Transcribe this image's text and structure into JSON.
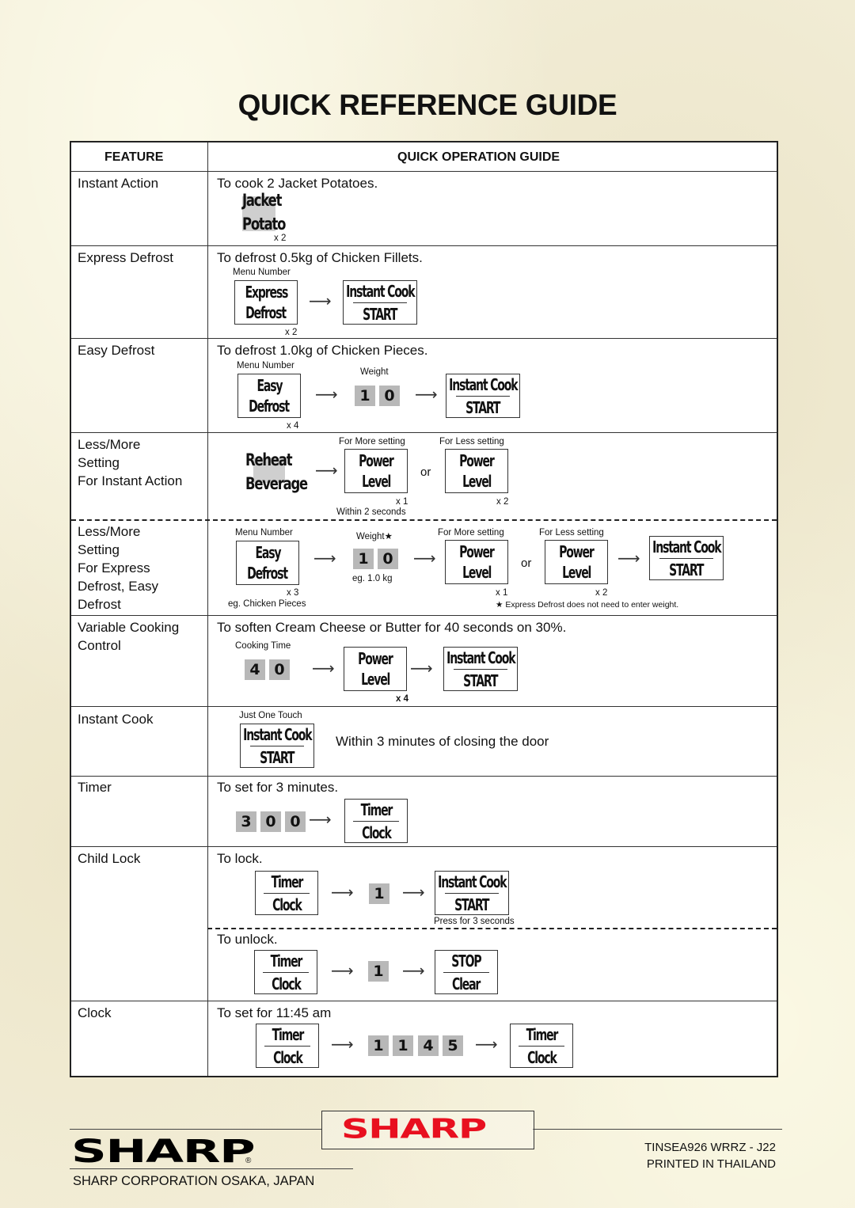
{
  "page_title": "QUICK REFERENCE GUIDE",
  "header": {
    "feature": "FEATURE",
    "guide": "QUICK OPERATION GUIDE"
  },
  "rows": {
    "instant_action": {
      "feature": "Instant Action",
      "desc": "To cook 2 Jacket Potatoes.",
      "key": {
        "line1": "Jacket",
        "line2": "Potato"
      },
      "count": "x 2"
    },
    "express_defrost": {
      "feature": "Express Defrost",
      "desc": "To defrost 0.5kg of Chicken Fillets.",
      "menu_number": "Menu Number",
      "key1": {
        "line1": "Express",
        "line2": "Defrost"
      },
      "key2": {
        "line1": "Instant Cook",
        "line2": "START"
      },
      "count": "x 2"
    },
    "easy_defrost": {
      "feature": "Easy Defrost",
      "desc": "To defrost 1.0kg of Chicken Pieces.",
      "menu_number": "Menu Number",
      "weight_label": "Weight",
      "key1": {
        "line1": "Easy",
        "line2": "Defrost"
      },
      "digits": [
        "1",
        "0"
      ],
      "key2": {
        "line1": "Instant Cook",
        "line2": "START"
      },
      "count": "x 4"
    },
    "less_more_instant": {
      "feature_lines": [
        "Less/More",
        "Setting",
        "For Instant Action"
      ],
      "key1": {
        "line1": "Reheat",
        "line2": "Beverage"
      },
      "more_label": "For More setting",
      "less_label": "For Less setting",
      "key_more": {
        "line1": "Power",
        "line2": "Level"
      },
      "key_less": {
        "line1": "Power",
        "line2": "Level"
      },
      "or": "or",
      "count_more": "x 1",
      "count_less": "x 2",
      "note": "Within 2 seconds"
    },
    "less_more_defrost": {
      "feature_lines": [
        "Less/More",
        "Setting",
        "For Express",
        "Defrost, Easy",
        "Defrost"
      ],
      "menu_number": "Menu Number",
      "weight_label": "Weight★",
      "key1": {
        "line1": "Easy",
        "line2": "Defrost"
      },
      "digits": [
        "1",
        "0"
      ],
      "weight_example": "eg. 1.0 kg",
      "count1": "x 3",
      "example": "eg. Chicken Pieces",
      "more_label": "For More setting",
      "less_label": "For Less setting",
      "key_more": {
        "line1": "Power",
        "line2": "Level"
      },
      "key_less": {
        "line1": "Power",
        "line2": "Level"
      },
      "or": "or",
      "count_more": "x 1",
      "count_less": "x 2",
      "key_start": {
        "line1": "Instant Cook",
        "line2": "START"
      },
      "footnote": "★ Express Defrost does not need to enter weight."
    },
    "variable_cooking": {
      "feature_lines": [
        "Variable Cooking",
        "Control"
      ],
      "desc": "To soften Cream Cheese or Butter for 40 seconds on 30%.",
      "time_label": "Cooking Time",
      "digits": [
        "4",
        "0"
      ],
      "key1": {
        "line1": "Power",
        "line2": "Level"
      },
      "key2": {
        "line1": "Instant Cook",
        "line2": "START"
      },
      "count": "x 4"
    },
    "instant_cook": {
      "feature": "Instant Cook",
      "label": "Just One Touch",
      "key": {
        "line1": "Instant Cook",
        "line2": "START"
      },
      "note": "Within 3 minutes of closing the door"
    },
    "timer": {
      "feature": "Timer",
      "desc": "To set for 3 minutes.",
      "digits": [
        "3",
        "0",
        "0"
      ],
      "key": {
        "line1": "Timer",
        "line2": "Clock"
      }
    },
    "child_lock": {
      "feature": "Child Lock",
      "lock_desc": "To lock.",
      "lock_key1": {
        "line1": "Timer",
        "line2": "Clock"
      },
      "lock_digit": "1",
      "lock_key2": {
        "line1": "Instant Cook",
        "line2": "START"
      },
      "lock_note": "Press for 3 seconds",
      "unlock_desc": "To unlock.",
      "unlock_key1": {
        "line1": "Timer",
        "line2": "Clock"
      },
      "unlock_digit": "1",
      "unlock_key2": {
        "line1": "STOP",
        "line2": "Clear"
      }
    },
    "clock": {
      "feature": "Clock",
      "desc": "To set for 11:45 am",
      "key1": {
        "line1": "Timer",
        "line2": "Clock"
      },
      "digits": [
        "1",
        "1",
        "4",
        "5"
      ],
      "key2": {
        "line1": "Timer",
        "line2": "Clock"
      }
    }
  },
  "arrow_glyph": "⟶",
  "footer": {
    "brand_logo": "SHARP",
    "registered": "®",
    "company": "SHARP CORPORATION OSAKA, JAPAN",
    "code_line1": "TINSEA926 WRRZ - J22",
    "code_line2": "PRINTED IN THAILAND",
    "brand_red": "#e8101f"
  }
}
